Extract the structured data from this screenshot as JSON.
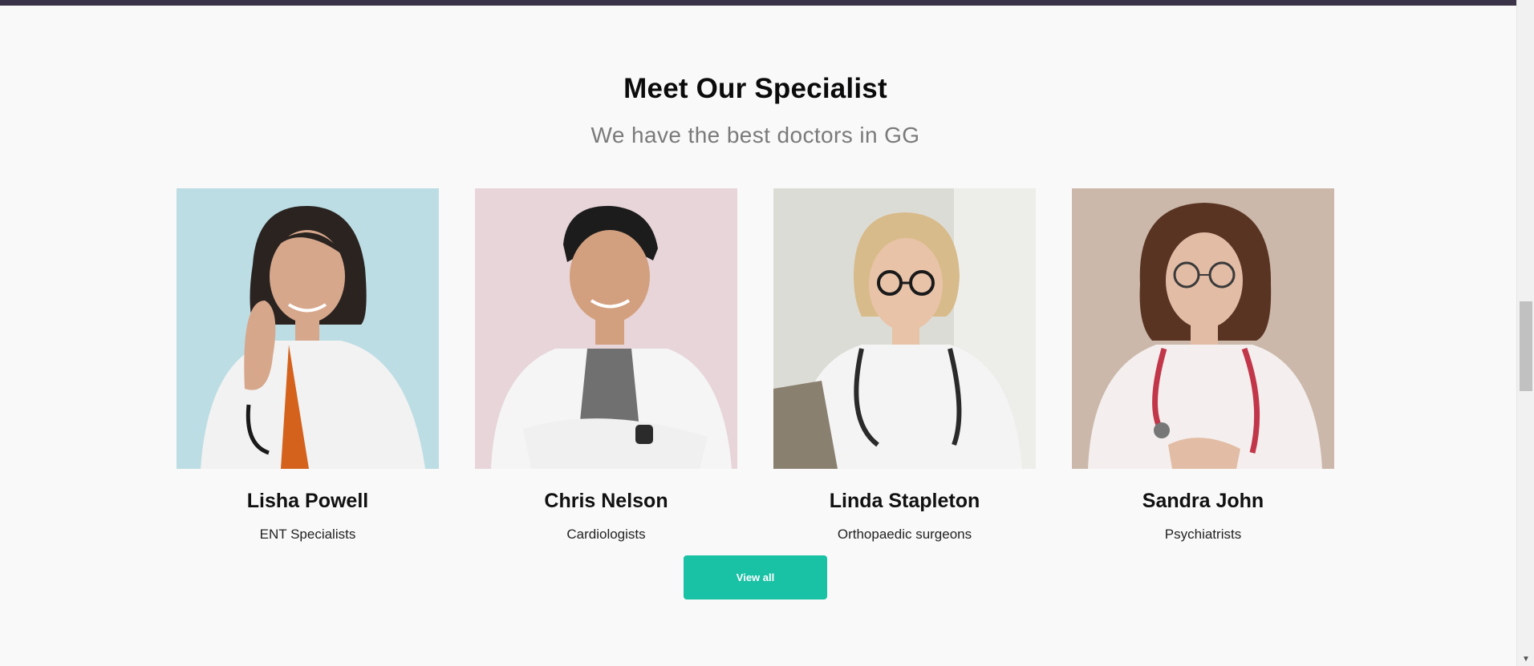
{
  "section": {
    "title": "Meet Our Specialist",
    "subtitle": "We have the best doctors in GG"
  },
  "doctors": [
    {
      "name": "Lisha Powell",
      "role": "ENT Specialists",
      "photo_bg": "#bcdde4"
    },
    {
      "name": "Chris Nelson",
      "role": "Cardiologists",
      "photo_bg": "#e8d5d9"
    },
    {
      "name": "Linda Stapleton",
      "role": "Orthopaedic surgeons",
      "photo_bg": "#dcdcd6"
    },
    {
      "name": "Sandra John",
      "role": "Psychiatrists",
      "photo_bg": "#cbb8aa"
    }
  ],
  "button": {
    "label": "View all",
    "color": "#19c1a5"
  },
  "colors": {
    "top_bar": "#3b3347",
    "background": "#f9f9fa"
  },
  "icons": {
    "scroll_down": "chevron-down-icon"
  }
}
